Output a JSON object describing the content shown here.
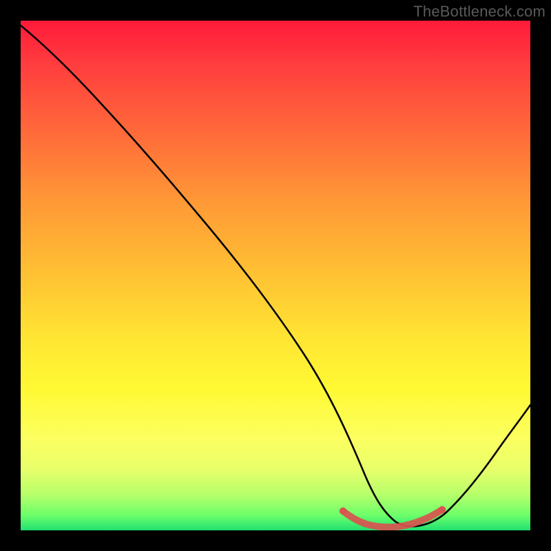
{
  "watermark": "TheBottleneck.com",
  "chart_data": {
    "type": "line",
    "title": "",
    "xlabel": "",
    "ylabel": "",
    "xlim": [
      0,
      100
    ],
    "ylim": [
      0,
      100
    ],
    "grid": false,
    "legend": false,
    "series": [
      {
        "name": "curve",
        "x": [
          0,
          5,
          10,
          15,
          20,
          25,
          30,
          35,
          40,
          45,
          50,
          55,
          60,
          63,
          68,
          72,
          75,
          78,
          82,
          86,
          90,
          95,
          100
        ],
        "y": [
          99,
          95,
          90,
          83,
          76,
          69,
          62,
          54,
          46,
          38,
          30,
          22,
          14,
          8,
          3,
          1,
          1,
          1,
          2,
          4,
          8,
          15,
          24
        ]
      }
    ],
    "highlight": {
      "name": "min-band",
      "x": [
        63,
        66,
        69,
        72,
        75,
        78,
        81
      ],
      "y": [
        3.5,
        2.2,
        1.4,
        1.1,
        1.1,
        1.6,
        2.8
      ],
      "color": "#d9534f"
    },
    "background_gradient": {
      "top_color": "#ff1a3a",
      "mid_color": "#ffe433",
      "bottom_color": "#20e070"
    }
  }
}
